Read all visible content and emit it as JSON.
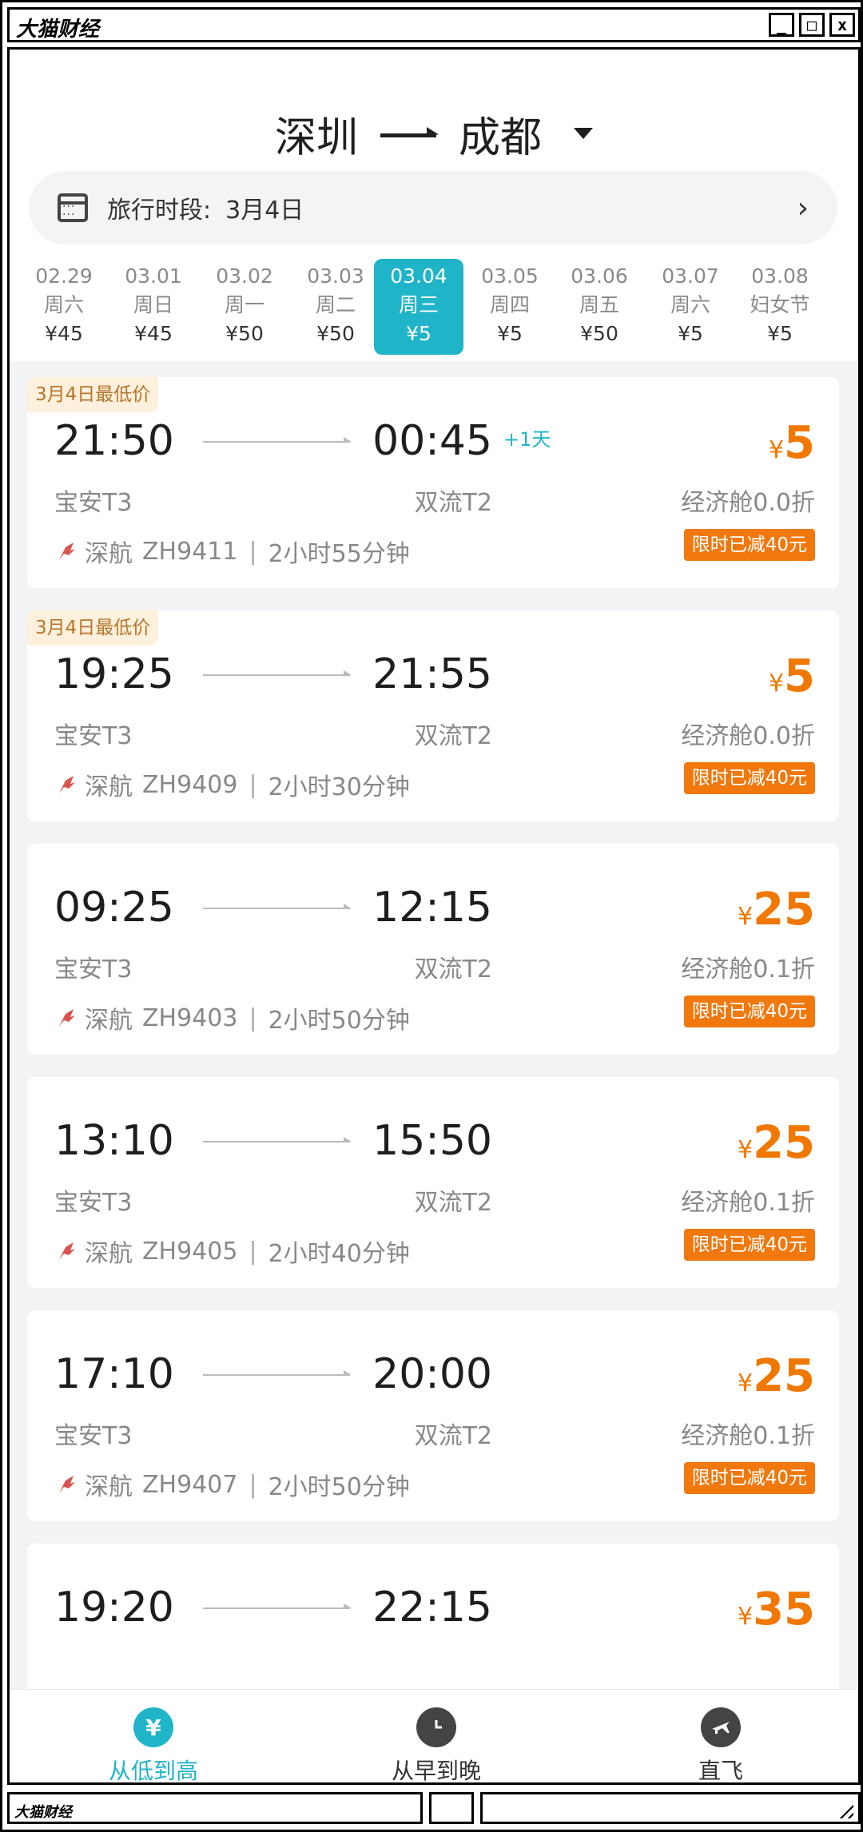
{
  "window": {
    "title": "大猫财经",
    "buttons": {
      "minimize": "_",
      "maximize": "□",
      "close": "x"
    }
  },
  "route": {
    "from": "深圳",
    "to": "成都"
  },
  "period": {
    "label": "旅行时段:",
    "value": "3月4日",
    "chevron": "›"
  },
  "dates": [
    {
      "date": "02.29",
      "day": "周六",
      "price": "¥45"
    },
    {
      "date": "03.01",
      "day": "周日",
      "price": "¥45"
    },
    {
      "date": "03.02",
      "day": "周一",
      "price": "¥50"
    },
    {
      "date": "03.03",
      "day": "周二",
      "price": "¥50"
    },
    {
      "date": "03.04",
      "day": "周三",
      "price": "¥5",
      "active": true
    },
    {
      "date": "03.05",
      "day": "周四",
      "price": "¥5"
    },
    {
      "date": "03.06",
      "day": "周五",
      "price": "¥50"
    },
    {
      "date": "03.07",
      "day": "周六",
      "price": "¥5"
    },
    {
      "date": "03.08",
      "day": "妇女节",
      "price": "¥5"
    }
  ],
  "flights": [
    {
      "badge": "3月4日最低价",
      "dep": "21:50",
      "arr": "00:45",
      "plus": "+1天",
      "dep_ap": "宝安T3",
      "arr_ap": "双流T2",
      "airline": "深航",
      "flight_no": "ZH9411",
      "duration": "2小时55分钟",
      "yen": "¥",
      "price": "5",
      "cabin": "经济舱0.0折",
      "promo": "限时已减40元"
    },
    {
      "badge": "3月4日最低价",
      "dep": "19:25",
      "arr": "21:55",
      "plus": "",
      "dep_ap": "宝安T3",
      "arr_ap": "双流T2",
      "airline": "深航",
      "flight_no": "ZH9409",
      "duration": "2小时30分钟",
      "yen": "¥",
      "price": "5",
      "cabin": "经济舱0.0折",
      "promo": "限时已减40元"
    },
    {
      "badge": "",
      "dep": "09:25",
      "arr": "12:15",
      "plus": "",
      "dep_ap": "宝安T3",
      "arr_ap": "双流T2",
      "airline": "深航",
      "flight_no": "ZH9403",
      "duration": "2小时50分钟",
      "yen": "¥",
      "price": "25",
      "cabin": "经济舱0.1折",
      "promo": "限时已减40元"
    },
    {
      "badge": "",
      "dep": "13:10",
      "arr": "15:50",
      "plus": "",
      "dep_ap": "宝安T3",
      "arr_ap": "双流T2",
      "airline": "深航",
      "flight_no": "ZH9405",
      "duration": "2小时40分钟",
      "yen": "¥",
      "price": "25",
      "cabin": "经济舱0.1折",
      "promo": "限时已减40元"
    },
    {
      "badge": "",
      "dep": "17:10",
      "arr": "20:00",
      "plus": "",
      "dep_ap": "宝安T3",
      "arr_ap": "双流T2",
      "airline": "深航",
      "flight_no": "ZH9407",
      "duration": "2小时50分钟",
      "yen": "¥",
      "price": "25",
      "cabin": "经济舱0.1折",
      "promo": "限时已减40元"
    },
    {
      "badge": "",
      "dep": "19:20",
      "arr": "22:15",
      "plus": "",
      "dep_ap": "",
      "arr_ap": "",
      "airline": "",
      "flight_no": "",
      "duration": "",
      "yen": "¥",
      "price": "35",
      "cabin": "",
      "promo": ""
    }
  ],
  "tabs": [
    {
      "label": "从低到高",
      "icon": "¥"
    },
    {
      "label": "从早到晚",
      "icon": ""
    },
    {
      "label": "直飞",
      "icon": ""
    }
  ],
  "statusbar": {
    "brand": "大猫财经"
  },
  "colors": {
    "accent": "#20b4c8",
    "price": "#f07800",
    "badge_bg": "#fdf0dc",
    "badge_text": "#b6762b"
  }
}
